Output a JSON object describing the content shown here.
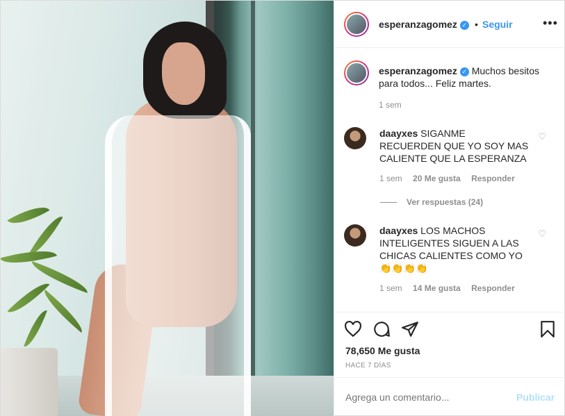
{
  "header": {
    "username": "esperanzagomez",
    "dot": "•",
    "follow_label": "Seguir",
    "more_label": "•••"
  },
  "caption": {
    "username": "esperanzagomez",
    "text_line1": "Muchos besitos",
    "text_line2": "para todos... Feliz martes.",
    "time": "1 sem"
  },
  "comments": [
    {
      "username": "daayxes",
      "line1": "SIGANME",
      "line2": "RECUERDEN QUE YO SOY MAS",
      "line3": "CALIENTE QUE LA ESPERANZA",
      "time": "1 sem",
      "likes": "20 Me gusta",
      "reply_label": "Responder",
      "view_replies": "Ver respuestas (24)"
    },
    {
      "username": "daayxes",
      "line1": "LOS MACHOS",
      "line2": "INTELIGENTES SIGUEN A LAS",
      "line3": "CHICAS CALIENTES COMO YO",
      "emoji": "👏👏👏👏",
      "time": "1 sem",
      "likes": "14 Me gusta",
      "reply_label": "Responder"
    }
  ],
  "actions": {
    "icons": [
      "heart-icon",
      "comment-icon",
      "share-icon",
      "bookmark-icon"
    ],
    "likes": "78,650 Me gusta",
    "time": "HACE 7 DÍAS"
  },
  "add_comment": {
    "placeholder": "Agrega un comentario...",
    "post_label": "Publicar"
  },
  "colors": {
    "link_blue": "#3897f0",
    "muted": "#8e8e8e",
    "publish_disabled": "#b2dffc"
  }
}
